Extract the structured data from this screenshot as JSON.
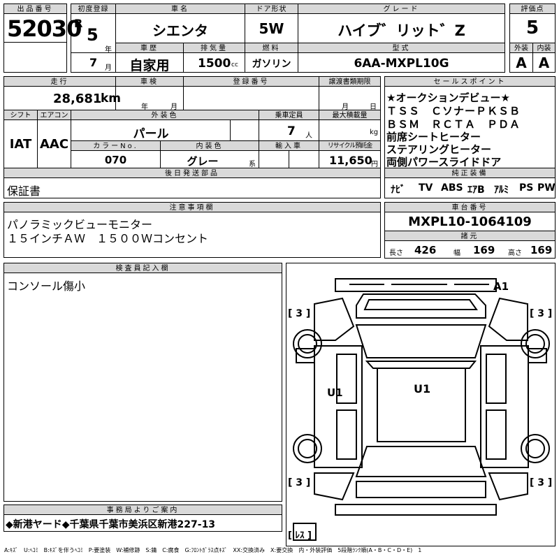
{
  "lot": {
    "label": "出品番号",
    "value": "52030"
  },
  "first_reg": {
    "label": "初度登録",
    "era": "R",
    "year": "5",
    "year_unit": "年",
    "month": "7",
    "month_unit": "月"
  },
  "car_name": {
    "label": "車名",
    "value": "シエンタ"
  },
  "door": {
    "label": "ドア形状",
    "value": "5W"
  },
  "grade": {
    "label": "グレード",
    "value": "ハイブ゛リット゛Z"
  },
  "score": {
    "label": "評価点",
    "value": "5",
    "ext_label": "外装",
    "ext": "A",
    "int_label": "内装",
    "int": "A"
  },
  "history": {
    "label": "車歴",
    "value": "自家用"
  },
  "displacement": {
    "label": "排気量",
    "value": "1500",
    "unit": "cc"
  },
  "fuel": {
    "label": "燃料",
    "value": "ガソリン"
  },
  "model": {
    "label": "型式",
    "value": "6AA-MXPL10G"
  },
  "mileage": {
    "label": "走行",
    "value": "28,681",
    "unit": "km"
  },
  "inspection": {
    "label": "車検",
    "year_unit": "年",
    "month_unit": "月"
  },
  "plate": {
    "label": "登録番号"
  },
  "transfer": {
    "label": "譲渡書類期限",
    "month_unit": "月",
    "day_unit": "日"
  },
  "shift": {
    "label": "シフト",
    "value": "IAT"
  },
  "aircon": {
    "label": "エアコン",
    "value": "AAC"
  },
  "ext_color": {
    "label": "外装色",
    "value": "パール"
  },
  "capacity": {
    "label": "乗車定員",
    "value": "7",
    "unit": "人"
  },
  "max_load": {
    "label": "最大積載量",
    "unit": "kg"
  },
  "color_no": {
    "label": "カラーNo.",
    "value": "070"
  },
  "int_color": {
    "label": "内装色",
    "value": "グレー",
    "unit": "系"
  },
  "import": {
    "label": "輸入車"
  },
  "recycle": {
    "label": "リサイクル預託金",
    "value": "11,650",
    "unit": "円"
  },
  "delivery": {
    "label": "後日発送部品",
    "value": "保証書"
  },
  "selling_points": {
    "label": "セールスポイント",
    "lines": [
      "★オークションデビュー★",
      "ＴＳＳ　ＣソナーＰＫＳＢ",
      "ＢＳＭ　ＲＣＴＡ　ＰＤＡ",
      "前席シートヒーター",
      "ステアリングヒーター",
      "両側パワースライドドア"
    ]
  },
  "equipment": {
    "label": "純正装備",
    "items": [
      "ﾅﾋﾞ",
      "TV",
      "ABS",
      "ｴｱB",
      "ｱﾙﾐ",
      "PS",
      "PW"
    ]
  },
  "notes": {
    "label": "注意事項欄",
    "lines": [
      "パノラミックビューモニター",
      "１５インチＡＷ　１５００Ｗコンセント"
    ]
  },
  "chassis": {
    "label": "車台番号",
    "value": "MXPL10-1064109"
  },
  "dims": {
    "label": "諸元",
    "length_label": "長さ",
    "length": "426",
    "width_label": "幅",
    "width": "169",
    "height_label": "高さ",
    "height": "169"
  },
  "inspector": {
    "label": "検査員記入欄",
    "value": "コンソール傷小"
  },
  "diagram": {
    "a1": "A1",
    "u1_left": "U1",
    "u1_roof": "U1",
    "tire_fl": "3",
    "tire_fr": "3",
    "tire_rl": "3",
    "tire_rr": "3",
    "spare": "ﾚｽ"
  },
  "office": {
    "label": "事務局よりご案内",
    "value": "◆新港ヤード◆千葉県千葉市美浜区新港227-13"
  },
  "legend": "A:ｷｽﾞ　U:ﾍｺﾐ　B:ｷｽﾞを伴うﾍｺﾐ　P:要塗装　W:補修跡　S:錆　C:腐食　G:ﾌﾛﾝﾄｶﾞﾗｽ点ｷｽﾞ　XX:交換済み　X:要交換　内・外装評価　5段階ﾗﾝｸ順(A・B・C・D・E)　1"
}
